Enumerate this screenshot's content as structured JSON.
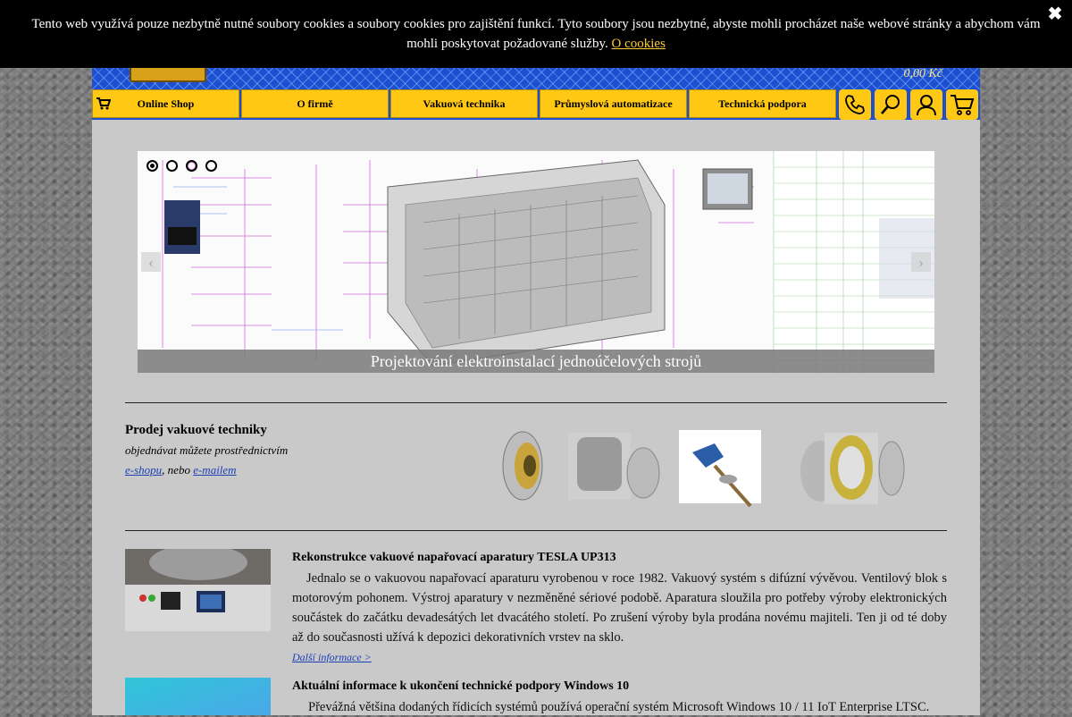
{
  "cookie_bar": {
    "text": "Tento web využívá pouze nezbytně nutné soubory cookies a soubory cookies pro zajištění funkcí. Tyto soubory jsou nezbytné, abyste mohli procházet naše webové stránky a abychom vám mohli poskytovat požadované služby.",
    "link": "O cookies",
    "close_icon": "close-icon"
  },
  "header": {
    "cart_total": "0,00 Kč"
  },
  "nav": {
    "items": [
      {
        "label": "Online Shop"
      },
      {
        "label": "O firmě"
      },
      {
        "label": "Vakuová technika"
      },
      {
        "label": "Průmyslová automatizace"
      },
      {
        "label": "Technická podpora"
      }
    ],
    "icons": [
      "phone-icon",
      "search-icon",
      "user-icon",
      "cart-icon"
    ]
  },
  "slider": {
    "caption": "Projektování elektroinstalací jednoúčelových strojů",
    "dots": 4,
    "active_dot": 1
  },
  "vacuum": {
    "title": "Prodej vakuové techniky",
    "subtitle": "objednávat můžete prostřednictvím",
    "link_shop": "e-shopu",
    "sep": ", nebo",
    "link_mail": "e-mailem"
  },
  "articles": [
    {
      "title": "Rekonstrukce vakuové napařovací aparatury TESLA UP313",
      "body": "Jednalo se o vakuovou napařovací aparaturu vyrobenou v roce 1982. Vakuový systém s difúzní vývěvou. Ventilový blok s motorovým pohonem. Výstroj aparatury v nezměněné sériové podobě. Aparatura sloužila pro potřeby výroby elektronických součástek do začátku devadesátých let dvacátého století. Po zrušení výroby byla prodána novému majiteli. Ten ji od té doby až do současnosti užívá k depozici dekorativních vrstev na sklo.",
      "more": "Další informace >"
    },
    {
      "title": "Aktuální informace k ukončení technické podpory Windows 10",
      "body": "Převážná většina dodaných řídicích systémů používá operační systém Microsoft Windows 10 / 11 IoT Enterprise LTSC."
    }
  ],
  "colors": {
    "nav_yellow": "#ffc814",
    "header_blue": "#1d4fd0",
    "link_blue": "#1a3fb5"
  }
}
